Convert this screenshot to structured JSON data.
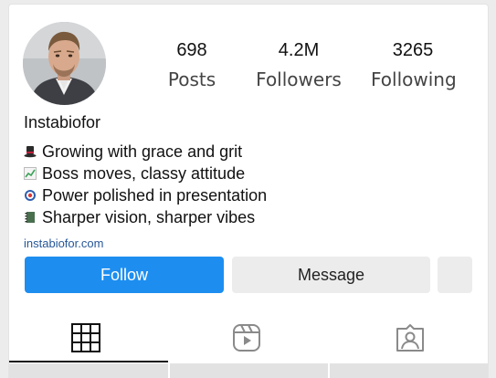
{
  "profile": {
    "username": "Instabiofor",
    "avatar": "profile-photo",
    "website": "instabiofor.com"
  },
  "stats": {
    "posts": {
      "value": "698",
      "label": "Posts"
    },
    "followers": {
      "value": "4.2M",
      "label": "Followers"
    },
    "following": {
      "value": "3265",
      "label": "Following"
    }
  },
  "bio": [
    {
      "icon": "top-hat-icon",
      "text": "Growing with grace and grit"
    },
    {
      "icon": "chart-increasing-icon",
      "text": "Boss moves, classy attitude"
    },
    {
      "icon": "bullseye-icon",
      "text": "Power polished in presentation"
    },
    {
      "icon": "notebook-icon",
      "text": "Sharper vision, sharper vibes"
    }
  ],
  "actions": {
    "follow_label": "Follow",
    "message_label": "Message"
  },
  "tabs": [
    {
      "icon": "grid-icon",
      "active": true
    },
    {
      "icon": "reels-icon",
      "active": false
    },
    {
      "icon": "tagged-icon",
      "active": false
    }
  ],
  "colors": {
    "follow_button": "#1d8ef0",
    "secondary_button": "#ececec",
    "link": "#27579a",
    "text": "#111111"
  }
}
